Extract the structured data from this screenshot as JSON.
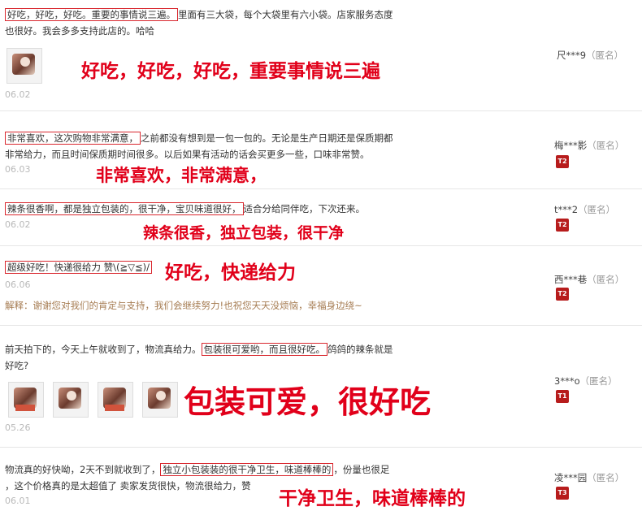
{
  "reviews": [
    {
      "text_highlight": "好吃，好吃，好吃。重要的事情说三遍。",
      "text_rest_line1": "里面有三大袋，每个大袋里有六小袋。店家服务态度",
      "text_line2": "也很好。我会多多支持此店的。哈哈",
      "date": "06.02",
      "annotation": "好吃，好吃，好吃，重要事情说三遍",
      "user": "尺***9",
      "anon": "（匿名）"
    },
    {
      "text_highlight": "非常喜欢，这次购物非常满意，",
      "text_rest_line1": "之前都没有想到是一包一包的。无论是生产日期还是保质期都",
      "text_line2": "非常给力，而且时间保质期时间很多。以后如果有活动的话会买更多一些，口味非常赞。",
      "date": "06.03",
      "annotation": "非常喜欢，非常满意，",
      "user": "梅***影",
      "anon": "（匿名）",
      "badge": "T2"
    },
    {
      "text_highlight": "辣条很香啊，都是独立包装的，很干净，宝贝味道很好，",
      "text_rest_line1": "适合分给同伴吃，下次还来。",
      "date": "06.02",
      "annotation": "辣条很香，独立包装，很干净",
      "user": "t***2",
      "anon": "（匿名）",
      "badge": "T2"
    },
    {
      "text_highlight": "超级好吃！快递很给力 赞\\(≧▽≦)/",
      "date": "06.06",
      "annotation": "好吃，快递给力",
      "reply": "解释：谢谢您对我们的肯定与支持，我们会继续努力!也祝您天天没烦恼，幸福身边绕~",
      "user": "西***巷",
      "anon": "（匿名）",
      "badge": "T2"
    },
    {
      "text_pre": "前天拍下的，今天上午就收到了，物流真给力。",
      "text_highlight": "包装很可爱哟，而且很好吃。",
      "text_rest_line1": "鸽鸽的辣条就是",
      "text_line2": "好吃?",
      "date": "05.26",
      "annotation": "包装可爱，很好吃",
      "user": "3***o",
      "anon": "（匿名）",
      "badge": "T1"
    },
    {
      "text_pre": "物流真的好快呦，2天不到就收到了，",
      "text_highlight": "独立小包装装的很干净卫生，味道棒棒的",
      "text_rest_line1": "，份量也很足",
      "text_line2": "，这个价格真的是太超值了 卖家发货很快，物流很给力，赞",
      "date": "06.01",
      "annotation": "干净卫生，味道棒棒的",
      "user": "凌***园",
      "anon": "（匿名）",
      "badge": "T3"
    }
  ]
}
